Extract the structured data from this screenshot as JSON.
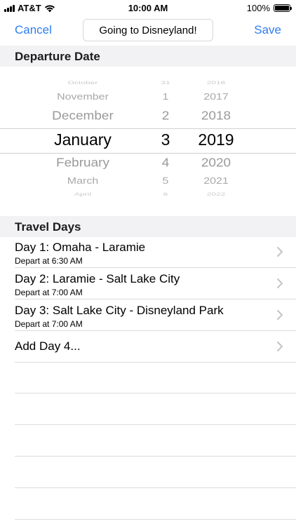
{
  "status_bar": {
    "carrier": "AT&T",
    "time": "10:00 AM",
    "battery": "100%",
    "battery_level": 1.0
  },
  "nav": {
    "cancel_label": "Cancel",
    "title_value": "Going to Disneyland!",
    "save_label": "Save"
  },
  "departure": {
    "header": "Departure Date",
    "picker": {
      "rows": [
        {
          "month": "October",
          "day": "31",
          "year": "2016"
        },
        {
          "month": "November",
          "day": "1",
          "year": "2017"
        },
        {
          "month": "December",
          "day": "2",
          "year": "2018"
        },
        {
          "month": "January",
          "day": "3",
          "year": "2019"
        },
        {
          "month": "February",
          "day": "4",
          "year": "2020"
        },
        {
          "month": "March",
          "day": "5",
          "year": "2021"
        },
        {
          "month": "April",
          "day": "6",
          "year": "2022"
        }
      ],
      "selected": {
        "month": "January",
        "day": "3",
        "year": "2019"
      }
    }
  },
  "travel_days": {
    "header": "Travel Days",
    "items": [
      {
        "title": "Day 1: Omaha - Laramie",
        "subtitle": "Depart at 6:30 AM"
      },
      {
        "title": "Day 2: Laramie - Salt Lake City",
        "subtitle": "Depart at 7:00 AM"
      },
      {
        "title": "Day 3: Salt Lake City - Disneyland Park",
        "subtitle": "Depart at 7:00 AM"
      },
      {
        "title": "Add Day 4...",
        "subtitle": ""
      }
    ]
  },
  "colors": {
    "accent": "#2f7ef0",
    "section_bg": "#f2f2f4",
    "separator": "#dcdcdc"
  }
}
